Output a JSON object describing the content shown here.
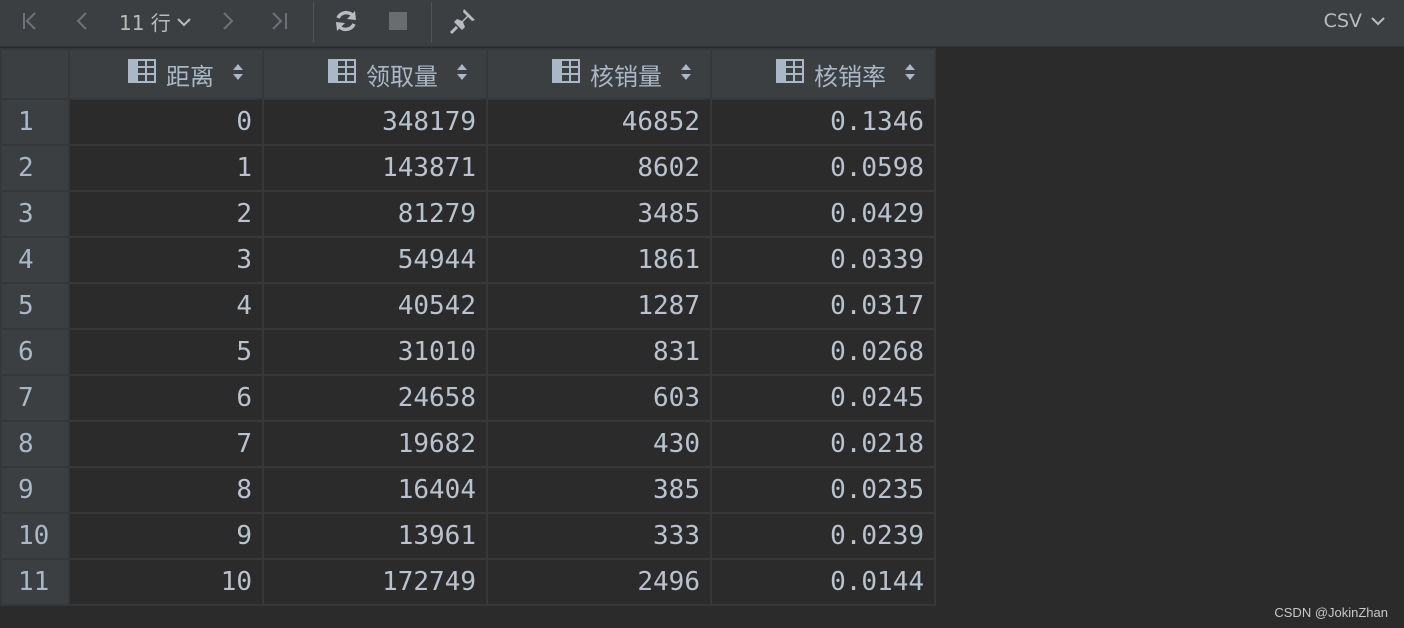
{
  "toolbar": {
    "row_count_label": "11 行",
    "export_format": "CSV"
  },
  "table": {
    "columns": [
      "距离",
      "领取量",
      "核销量",
      "核销率"
    ],
    "rows": [
      {
        "num": "1",
        "cells": [
          "0",
          "348179",
          "46852",
          "0.1346"
        ]
      },
      {
        "num": "2",
        "cells": [
          "1",
          "143871",
          "8602",
          "0.0598"
        ]
      },
      {
        "num": "3",
        "cells": [
          "2",
          "81279",
          "3485",
          "0.0429"
        ]
      },
      {
        "num": "4",
        "cells": [
          "3",
          "54944",
          "1861",
          "0.0339"
        ]
      },
      {
        "num": "5",
        "cells": [
          "4",
          "40542",
          "1287",
          "0.0317"
        ]
      },
      {
        "num": "6",
        "cells": [
          "5",
          "31010",
          "831",
          "0.0268"
        ]
      },
      {
        "num": "7",
        "cells": [
          "6",
          "24658",
          "603",
          "0.0245"
        ]
      },
      {
        "num": "8",
        "cells": [
          "7",
          "19682",
          "430",
          "0.0218"
        ]
      },
      {
        "num": "9",
        "cells": [
          "8",
          "16404",
          "385",
          "0.0235"
        ]
      },
      {
        "num": "10",
        "cells": [
          "9",
          "13961",
          "333",
          "0.0239"
        ]
      },
      {
        "num": "11",
        "cells": [
          "10",
          "172749",
          "2496",
          "0.0144"
        ]
      }
    ]
  },
  "watermark": "CSDN @JokinZhan",
  "icons": {
    "first": "first-page-icon",
    "prev": "previous-page-icon",
    "next": "next-page-icon",
    "last": "last-page-icon",
    "refresh": "refresh-icon",
    "stop": "stop-icon",
    "pin": "pin-icon",
    "column": "table-column-icon",
    "sort": "sort-icon"
  }
}
